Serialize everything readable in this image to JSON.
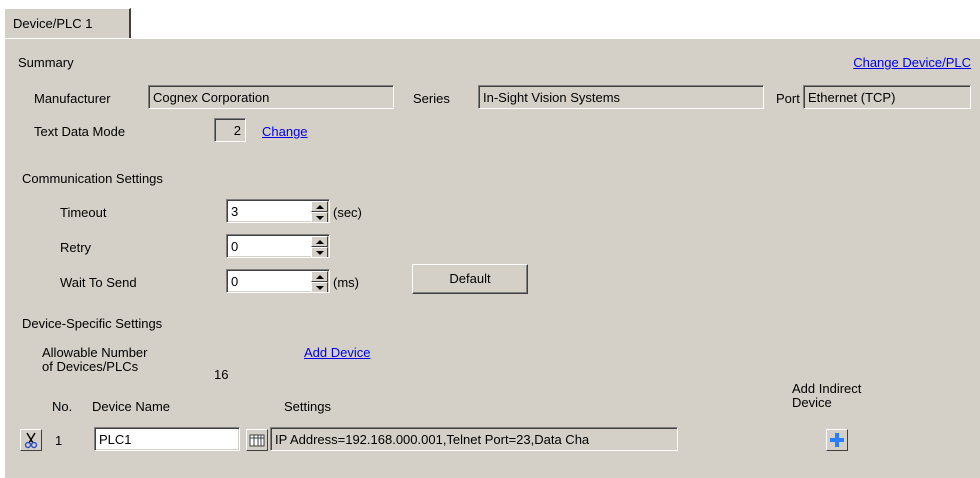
{
  "tab": {
    "label": "Device/PLC 1"
  },
  "summary": {
    "heading": "Summary",
    "change_device_link": "Change Device/PLC",
    "manufacturer_label": "Manufacturer",
    "manufacturer_value": "Cognex Corporation",
    "series_label": "Series",
    "series_value": "In-Sight Vision Systems",
    "port_label": "Port",
    "port_value": "Ethernet (TCP)",
    "text_data_mode_label": "Text Data Mode",
    "text_data_mode_value": "2",
    "change_link": "Change"
  },
  "comm": {
    "heading": "Communication Settings",
    "timeout_label": "Timeout",
    "timeout_value": "3",
    "timeout_unit": "(sec)",
    "retry_label": "Retry",
    "retry_value": "0",
    "wait_label": "Wait To Send",
    "wait_value": "0",
    "wait_unit": "(ms)",
    "default_button": "Default"
  },
  "device_specific": {
    "heading": "Device-Specific Settings",
    "allowable_line1": "Allowable Number",
    "allowable_line2": "of Devices/PLCs",
    "allowable_value": "16",
    "add_device_link": "Add Device",
    "col_no": "No.",
    "col_device_name": "Device Name",
    "col_settings": "Settings",
    "col_add_indirect_line1": "Add Indirect",
    "col_add_indirect_line2": "Device",
    "rows": [
      {
        "no": "1",
        "device_name": "PLC1",
        "settings": "IP Address=192.168.000.001,Telnet Port=23,Data Cha"
      }
    ]
  },
  "icons": {
    "row_tool": "scissors-icon",
    "settings_tool": "grid-settings-icon",
    "add_indirect": "plus-icon"
  },
  "colors": {
    "panel": "#d4d0c8",
    "link": "#0000ee",
    "accent_plus": "#2a7fff"
  }
}
